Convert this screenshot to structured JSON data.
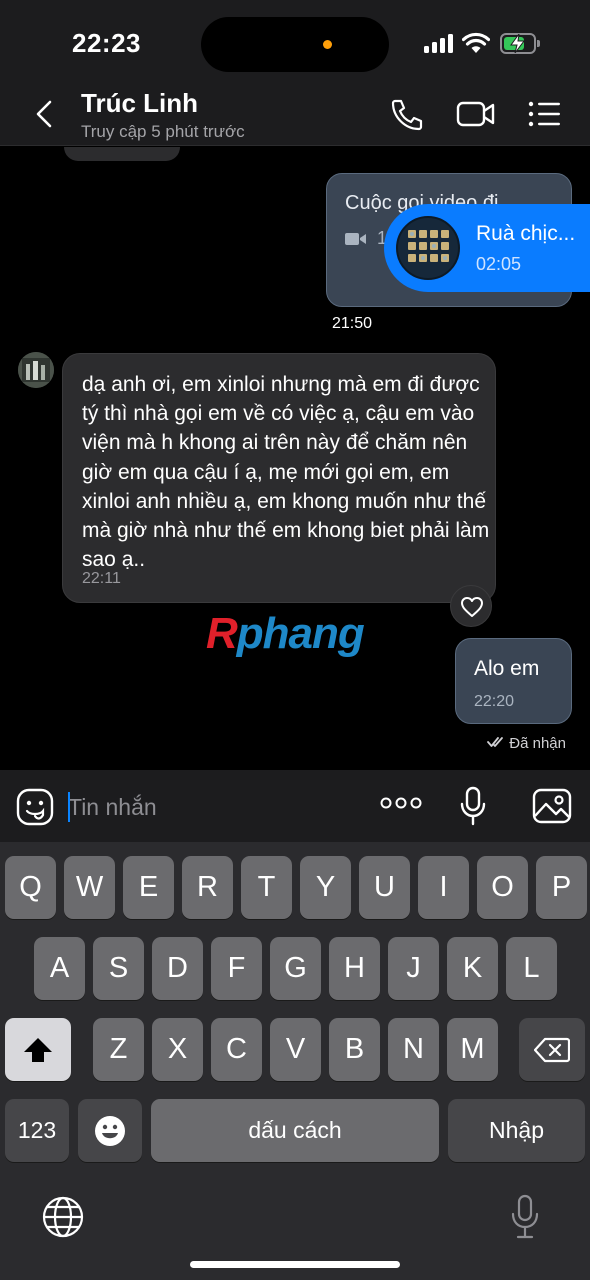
{
  "status_bar": {
    "time": "22:23"
  },
  "header": {
    "contact_name": "Trúc Linh",
    "contact_status": "Truy cập 5 phút trước",
    "icons": [
      "back-icon",
      "phone-icon",
      "video-camera-icon",
      "menu-list-icon"
    ]
  },
  "chat": {
    "call_message": {
      "title": "Cuộc gọi video đi",
      "duration": "1",
      "time": "21:50"
    },
    "mini_player": {
      "title": "Ruà chịc...",
      "time": "02:05"
    },
    "received_message": {
      "text": "dạ anh ơi, em xinloi nhưng mà em đi được tý thì nhà gọi em về có việc ạ, cậu em vào viện mà h khong ai trên này để chăm nên giờ em qua cậu í ạ, mẹ mới gọi em, em xinloi anh nhiều ạ, em khong muốn như thế mà giờ nhà như thế em khong biet phải làm sao ạ..",
      "time": "22:11"
    },
    "sent_message": {
      "text": "Alo em",
      "time": "22:20",
      "status": "Đã nhận"
    },
    "watermark": {
      "part1": "R",
      "part2": "phang"
    }
  },
  "composer": {
    "placeholder": "Tin nhắn"
  },
  "keyboard": {
    "row1": [
      "Q",
      "W",
      "E",
      "R",
      "T",
      "Y",
      "U",
      "I",
      "O",
      "P"
    ],
    "row2": [
      "A",
      "S",
      "D",
      "F",
      "G",
      "H",
      "J",
      "K",
      "L"
    ],
    "row3": [
      "Z",
      "X",
      "C",
      "V",
      "B",
      "N",
      "M"
    ],
    "numbers_label": "123",
    "space_label": "dấu cách",
    "return_label": "Nhập"
  },
  "colors": {
    "accent_blue": "#0a7cff",
    "bubble_sent": "#3a4554",
    "bubble_received": "#2c2c2e",
    "keyboard_bg": "#2b2b2e",
    "key": "#6b6b6e"
  }
}
